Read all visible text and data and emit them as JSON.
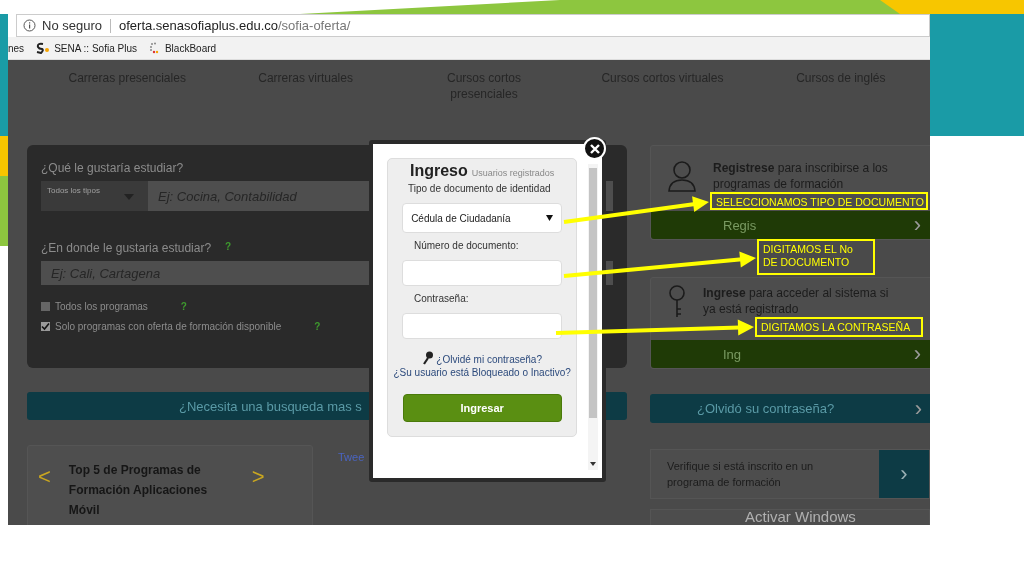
{
  "browser": {
    "security_label": "No seguro",
    "url_host": "oferta.senasofiaplus.edu.co",
    "url_path": "/sofia-oferta/",
    "bookmarks": [
      {
        "label": "nes",
        "kind": "text"
      },
      {
        "label": "SENA :: Sofia Plus",
        "kind": "sena"
      },
      {
        "label": "BlackBoard",
        "kind": "blackboard"
      }
    ]
  },
  "nav": [
    "Carreras presenciales",
    "Carreras virtuales",
    "Cursos cortos presenciales",
    "Cursos cortos virtuales",
    "Cursos de inglés"
  ],
  "search_panel": {
    "question": "¿Qué le gustaría estudiar?",
    "type_select": "Todos los tipos",
    "program_placeholder": "Ej: Cocina, Contabilidad",
    "where_label": "¿En donde le gustaria estudiar?",
    "where_help": "?",
    "where_placeholder": "Ej: Cali, Cartagena",
    "options": [
      {
        "label": "Todos los programas",
        "checked": false,
        "help": "?"
      },
      {
        "label": "Solo programas con oferta de formación disponible",
        "checked": true,
        "help": "?"
      }
    ]
  },
  "advanced_search": "¿Necesita una busqueda mas s",
  "top_programs": {
    "prev": "<",
    "title": "Top 5 de Programas de Formación Aplicaciones Móvil",
    "next": ">"
  },
  "tweet": "Twee",
  "register_card": {
    "text": "**Registrese** para inscribirse a los programas de formación",
    "button": "Regis",
    "chevron": "›"
  },
  "login_card": {
    "text": "**Ingrese** para acceder al sistema si ya está registrado",
    "button": "Ing",
    "chevron": "›"
  },
  "forgot_button": {
    "label": "¿Olvidó su contraseña?",
    "chevron": "›"
  },
  "verify_card": {
    "text": "Verifique si está inscrito en un programa de formación",
    "chevron": "›"
  },
  "os_notice": "Activar Windows",
  "modal": {
    "title": "Ingreso",
    "subtitle": "Usuarios registrados",
    "doc_type_label": "Tipo de documento de identidad",
    "doc_type_value": "Cédula de Ciudadanía",
    "doc_number_label": "Número de documento:",
    "password_label": "Contraseña:",
    "forgot_link": "¿Olvidé mi contraseña?",
    "blocked_link": "¿Su usuario está Bloqueado o Inactivo?",
    "submit": "Ingresar"
  },
  "annotations": [
    {
      "text": "SELECCIONAMOS TIPO DE DOCUMENTO"
    },
    {
      "text": "DIGITAMOS EL No DE DOCUMENTO"
    },
    {
      "text": "DIGITAMOS LA CONTRASEÑA"
    }
  ]
}
